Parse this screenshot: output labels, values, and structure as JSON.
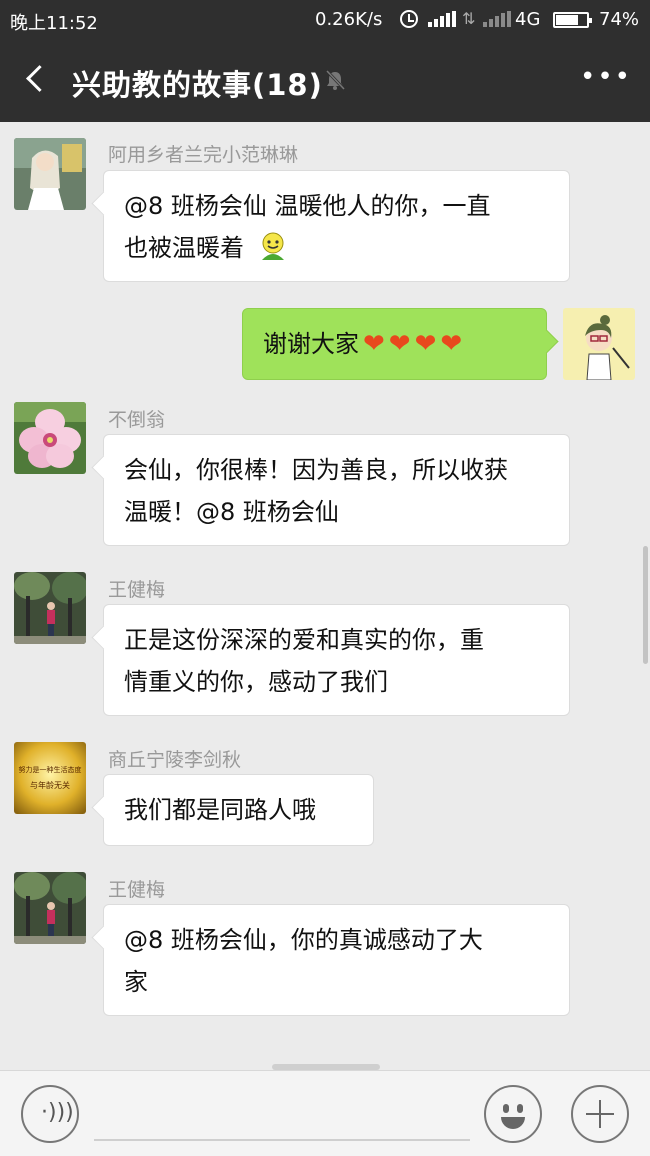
{
  "status_bar": {
    "time": "晚上11:52",
    "speed": "0.26K/s",
    "network": "4G",
    "battery_percent_text": "74%",
    "battery_level": 0.74,
    "icons": [
      "alarm-icon",
      "signal-icon",
      "data-arrows-icon",
      "signal-icon",
      "battery-icon"
    ]
  },
  "header": {
    "title": "兴助教的故事(18)",
    "back_icon": "chevron-left-icon",
    "mute_icon": "bell-muted-icon",
    "more_icon": "ellipsis-icon"
  },
  "messages": [
    {
      "side": "left",
      "sender": "阿用乡者兰完小范琳琳",
      "lines": [
        "@8 班杨会仙  温暖他人的你，一直",
        "也被温暖着"
      ],
      "emoji": "smiley-emoji"
    },
    {
      "side": "right",
      "text": "谢谢大家",
      "hearts": 4
    },
    {
      "side": "left",
      "sender": "不倒翁",
      "lines": [
        "会仙，你很棒！因为善良，所以收获",
        "温暖！@8 班杨会仙"
      ]
    },
    {
      "side": "left",
      "sender": "王健梅",
      "lines": [
        "正是这份深深的爱和真实的你，重",
        "情重义的你，感动了我们"
      ]
    },
    {
      "side": "left",
      "sender": "商丘宁陵李剑秋",
      "lines": [
        "我们都是同路人哦"
      ],
      "avatar_text": "努力是一种生活态度 与年龄无关"
    },
    {
      "side": "left",
      "sender": "王健梅",
      "lines": [
        "@8 班杨会仙，你的真诚感动了大",
        "家"
      ]
    }
  ],
  "input_bar": {
    "voice_icon": "voice-icon",
    "emoji_icon": "emoji-icon",
    "plus_icon": "plus-icon"
  },
  "colors": {
    "header_bg": "#2f2f2f",
    "chat_bg": "#ebebeb",
    "bubble_self": "#9fe25a",
    "bubble_other": "#ffffff",
    "heart": "#e8491d"
  }
}
